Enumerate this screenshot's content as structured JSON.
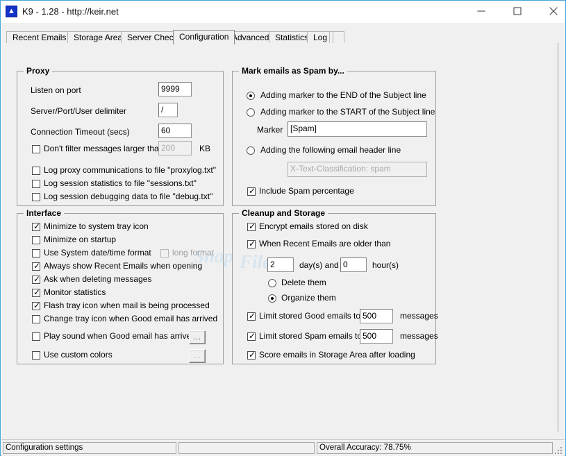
{
  "window": {
    "title": "K9 - 1.28 - http://keir.net",
    "icon": "app-icon",
    "controls": {
      "minimize": "minimize",
      "maximize": "maximize",
      "close": "close"
    }
  },
  "tabs": [
    {
      "label": "Recent Emails",
      "active": false
    },
    {
      "label": "Storage Area",
      "active": false
    },
    {
      "label": "Server Check",
      "active": false
    },
    {
      "label": "Configuration",
      "active": true
    },
    {
      "label": "Advanced",
      "active": false
    },
    {
      "label": "Statistics",
      "active": false
    },
    {
      "label": "Log",
      "active": false
    }
  ],
  "proxy": {
    "title": "Proxy",
    "listen_port_label": "Listen on port",
    "listen_port_value": "9999",
    "delimiter_label": "Server/Port/User delimiter",
    "delimiter_value": "/",
    "timeout_label": "Connection Timeout (secs)",
    "timeout_value": "60",
    "size_filter_label": "Don't filter messages larger than",
    "size_filter_checked": false,
    "size_filter_value": "200",
    "size_filter_unit": "KB",
    "log_proxy_label": "Log proxy communications to file \"proxylog.txt\"",
    "log_proxy_checked": false,
    "log_sessions_label": "Log session statistics to file \"sessions.txt\"",
    "log_sessions_checked": false,
    "log_debug_label": "Log session debugging data to file \"debug.txt\"",
    "log_debug_checked": false
  },
  "interface": {
    "title": "Interface",
    "items": [
      {
        "label": "Minimize to system tray icon",
        "checked": true
      },
      {
        "label": "Minimize on startup",
        "checked": false
      },
      {
        "label": "Use System date/time format",
        "checked": false
      },
      {
        "label": "Always show Recent Emails when opening",
        "checked": true
      },
      {
        "label": "Ask when deleting messages",
        "checked": true
      },
      {
        "label": "Monitor statistics",
        "checked": true
      },
      {
        "label": "Flash tray icon when mail is being processed",
        "checked": true
      },
      {
        "label": "Change tray icon when Good email has arrived",
        "checked": false
      },
      {
        "label": "Play sound when Good email has arrived",
        "checked": false
      },
      {
        "label": "Use custom colors",
        "checked": false
      }
    ],
    "long_format_label": "long format",
    "long_format_checked": false,
    "browse_sound_label": "...",
    "browse_colors_label": "..."
  },
  "spam": {
    "title": "Mark emails as Spam by...",
    "option_end_label": "Adding marker to the END of the Subject line",
    "option_start_label": "Adding marker to the START of the Subject line",
    "option_header_label": "Adding the following email header line",
    "selected_option": "end",
    "marker_label": "Marker",
    "marker_value": "[Spam]",
    "header_value": "X-Text-Classification: spam",
    "include_pct_label": "Include Spam percentage",
    "include_pct_checked": true
  },
  "cleanup": {
    "title": "Cleanup and Storage",
    "encrypt_label": "Encrypt emails stored on disk",
    "encrypt_checked": true,
    "older_than_label": "When Recent Emails are older than",
    "older_than_checked": true,
    "days_value": "2",
    "days_unit": "day(s) and",
    "hours_value": "0",
    "hours_unit": "hour(s)",
    "delete_label": "Delete them",
    "organize_label": "Organize them",
    "selected_action": "organize",
    "limit_good_label": "Limit stored Good emails to",
    "limit_good_checked": true,
    "limit_good_value": "500",
    "limit_good_unit": "messages",
    "limit_spam_label": "Limit stored Spam emails to",
    "limit_spam_checked": true,
    "limit_spam_value": "500",
    "limit_spam_unit": "messages",
    "score_label": "Score emails in Storage Area after loading",
    "score_checked": true
  },
  "watermark": {
    "part1": "Snap",
    "part2": "Files"
  },
  "statusbar": {
    "panel1": "Configuration settings",
    "panel2": "",
    "panel3": "Overall Accuracy: 78.75%"
  },
  "colors": {
    "window_border": "#4aa3d8",
    "face": "#f0f0f0",
    "field": "#ffffff",
    "disabled_text": "#a6a6a6"
  }
}
